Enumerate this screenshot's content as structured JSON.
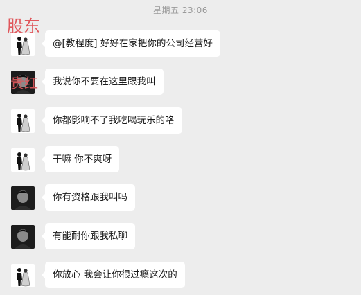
{
  "header": {
    "timestamp": "星期五 23:06"
  },
  "overlay_labels": {
    "top": "股东",
    "middle": "贵红"
  },
  "messages": [
    {
      "avatar": "couple-silhouette-icon",
      "text": "@[教程度] 好好在家把你的公司经营好"
    },
    {
      "avatar": "dark-portrait-icon",
      "text": "我说你不要在这里跟我叫"
    },
    {
      "avatar": "couple-silhouette-icon",
      "text": "你都影响不了我吃喝玩乐的咯"
    },
    {
      "avatar": "couple-silhouette-icon",
      "text": "干嘛 你不爽呀"
    },
    {
      "avatar": "dark-portrait-icon",
      "text": "你有资格跟我叫吗"
    },
    {
      "avatar": "dark-portrait-icon",
      "text": "有能耐你跟我私聊"
    },
    {
      "avatar": "couple-silhouette-icon",
      "text": "你放心 我会让你很过瘾这次的"
    }
  ]
}
